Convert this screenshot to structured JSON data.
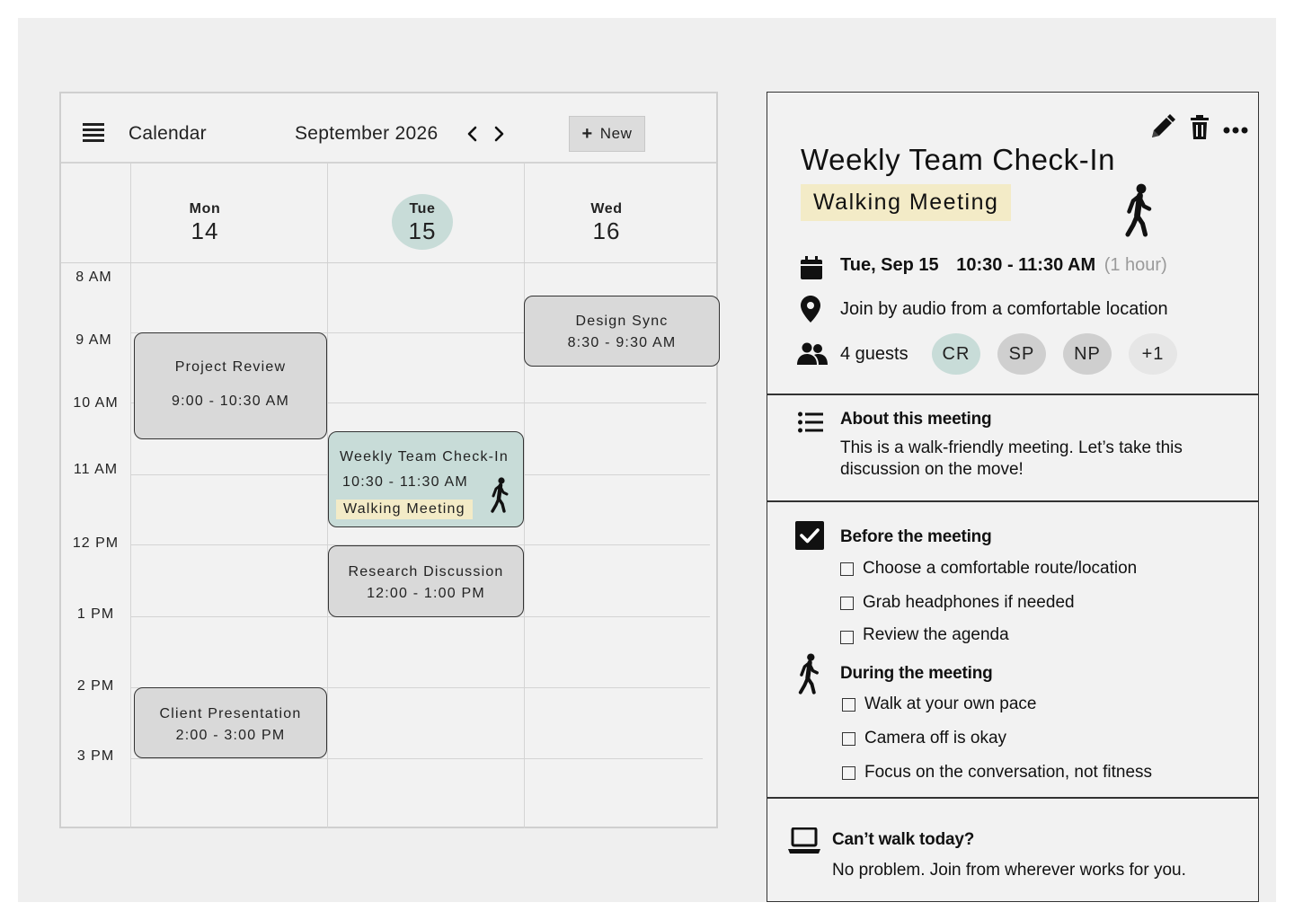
{
  "calendar": {
    "title": "Calendar",
    "month": "September 2026",
    "new_label": "New",
    "days": [
      {
        "name": "Mon",
        "num": "14"
      },
      {
        "name": "Tue",
        "num": "15"
      },
      {
        "name": "Wed",
        "num": "16"
      }
    ],
    "hours": [
      "8 AM",
      "9 AM",
      "10 AM",
      "11 AM",
      "12 PM",
      "1 PM",
      "2 PM",
      "3 PM"
    ],
    "events": {
      "design_sync": {
        "title": "Design Sync",
        "time": "8:30 - 9:30 AM"
      },
      "project_review": {
        "title": "Project Review",
        "time": "9:00 - 10:30 AM"
      },
      "weekly": {
        "title": "Weekly Team Check-In",
        "time": "10:30 - 11:30 AM",
        "tag": "Walking Meeting"
      },
      "research": {
        "title": "Research Discussion",
        "time": "12:00 - 1:00 PM"
      },
      "client": {
        "title": "Client Presentation",
        "time": "2:00 - 3:00 PM"
      }
    }
  },
  "details": {
    "title": "Weekly Team Check-In",
    "tag": "Walking Meeting",
    "date": "Tue, Sep 15",
    "time": "10:30 - 11:30 AM",
    "duration": "(1 hour)",
    "location": "Join by audio from a comfortable location",
    "guests_label": "4 guests",
    "guests": [
      "CR",
      "SP",
      "NP",
      "+1"
    ],
    "about": {
      "heading": "About this meeting",
      "body": "This is a walk-friendly meeting. Let’s take this discussion on the move!"
    },
    "before": {
      "heading": "Before the meeting",
      "items": [
        "Choose a comfortable route/location",
        "Grab headphones if needed",
        "Review the agenda"
      ]
    },
    "during": {
      "heading": "During the meeting",
      "items": [
        "Walk at your own pace",
        "Camera off is okay",
        "Focus on the conversation, not fitness"
      ]
    },
    "cant_walk": {
      "heading": "Can’t walk today?",
      "body": "No problem. Join from wherever works for you."
    }
  },
  "colors": {
    "canvas": "#efefef",
    "active_event": "#c8dcd8",
    "walk_tag": "#f3ebc7",
    "event": "#d9d9d9",
    "avatar_cr": "#c8dcd8",
    "avatar_gray": "#cfcfcf",
    "avatar_more": "#e6e6e6"
  },
  "icons": {
    "menu": "hamburger-icon",
    "prev": "chevron-left-icon",
    "next": "chevron-right-icon",
    "edit": "pencil-icon",
    "delete": "trash-icon",
    "more": "more-dots-icon",
    "walker": "walking-person-icon",
    "calendar": "calendar-icon",
    "location": "location-pin-icon",
    "guests": "people-icon",
    "about": "list-icon",
    "checklist": "checkbox-checked-icon",
    "laptop": "laptop-icon"
  }
}
